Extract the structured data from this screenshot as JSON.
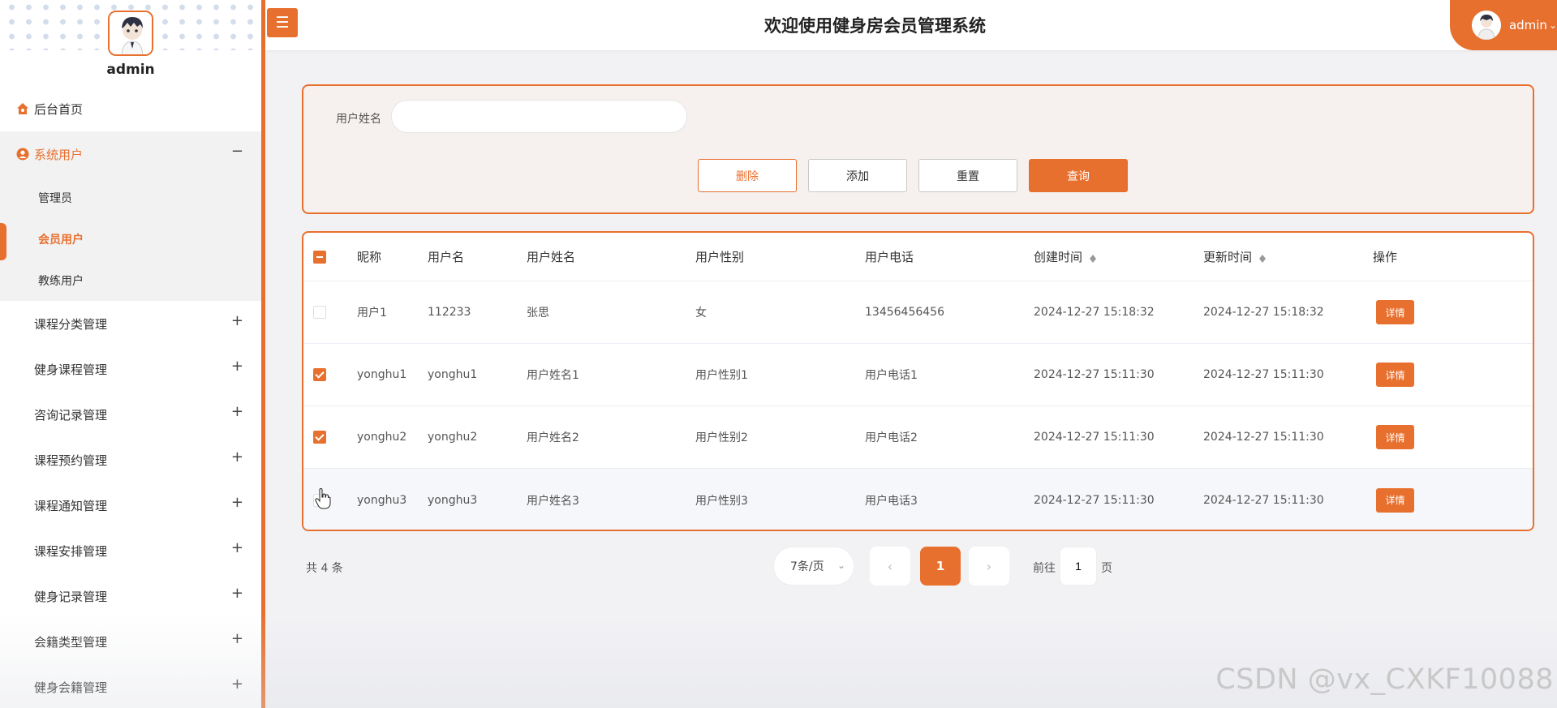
{
  "sidebar": {
    "username": "admin",
    "items": [
      {
        "label": "后台首页",
        "icon": "home-icon"
      },
      {
        "label": "系统用户",
        "icon": "user-circle-icon",
        "expanded_mark": "−",
        "children": [
          {
            "label": "管理员"
          },
          {
            "label": "会员用户"
          },
          {
            "label": "教练用户"
          }
        ]
      },
      {
        "label": "课程分类管理",
        "mark": "+"
      },
      {
        "label": "健身课程管理",
        "mark": "+"
      },
      {
        "label": "咨询记录管理",
        "mark": "+"
      },
      {
        "label": "课程预约管理",
        "mark": "+"
      },
      {
        "label": "课程通知管理",
        "mark": "+"
      },
      {
        "label": "课程安排管理",
        "mark": "+"
      },
      {
        "label": "健身记录管理",
        "mark": "+"
      },
      {
        "label": "会籍类型管理",
        "mark": "+"
      },
      {
        "label": "健身会籍管理",
        "mark": "+"
      }
    ]
  },
  "header": {
    "menu_icon": "☰",
    "title": "欢迎使用健身房会员管理系统",
    "user_label": "admin",
    "user_chevron": "⌄"
  },
  "search": {
    "label": "用户姓名",
    "value": "",
    "buttons": {
      "delete": "删除",
      "add": "添加",
      "reset": "重置",
      "query": "查询"
    }
  },
  "table": {
    "columns": [
      "昵称",
      "用户名",
      "用户姓名",
      "用户性别",
      "用户电话",
      "创建时间",
      "更新时间",
      "操作"
    ],
    "rows": [
      {
        "checked": false,
        "nickname": "用户1",
        "username": "112233",
        "realname": "张思",
        "gender": "女",
        "phone": "13456456456",
        "created": "2024-12-27 15:18:32",
        "updated": "2024-12-27 15:18:32",
        "action": "详情"
      },
      {
        "checked": true,
        "nickname": "yonghu1",
        "username": "yonghu1",
        "realname": "用户姓名1",
        "gender": "用户性别1",
        "phone": "用户电话1",
        "created": "2024-12-27 15:11:30",
        "updated": "2024-12-27 15:11:30",
        "action": "详情"
      },
      {
        "checked": true,
        "nickname": "yonghu2",
        "username": "yonghu2",
        "realname": "用户姓名2",
        "gender": "用户性别2",
        "phone": "用户电话2",
        "created": "2024-12-27 15:11:30",
        "updated": "2024-12-27 15:11:30",
        "action": "详情"
      },
      {
        "checked": false,
        "nickname": "yonghu3",
        "username": "yonghu3",
        "realname": "用户姓名3",
        "gender": "用户性别3",
        "phone": "用户电话3",
        "created": "2024-12-27 15:11:30",
        "updated": "2024-12-27 15:11:30",
        "action": "详情"
      }
    ]
  },
  "pagination": {
    "total": "共 4 条",
    "page_size": "7条/页",
    "prev": "‹",
    "current": "1",
    "next": "›",
    "goto_label": "前往",
    "goto_value": "1",
    "goto_unit": "页"
  },
  "watermark": "CSDN @vx_CXKF10088",
  "colors": {
    "accent": "#e8702f"
  }
}
